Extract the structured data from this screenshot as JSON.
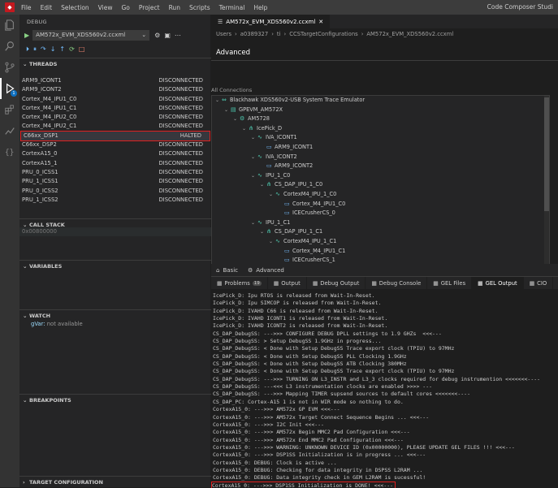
{
  "titlebar": {
    "menu": [
      "File",
      "Edit",
      "Selection",
      "View",
      "Go",
      "Project",
      "Run",
      "Scripts",
      "Terminal",
      "Help"
    ],
    "app_title": "Code Composer Studi"
  },
  "activity": {
    "debug_badge": "1"
  },
  "debug_panel": {
    "title": "DEBUG",
    "config": "AM572x_EVM_XDS560v2.ccxml",
    "sections": {
      "threads": "THREADS",
      "call_stack": "CALL STACK",
      "variables": "VARIABLES",
      "watch": "WATCH",
      "breakpoints": "BREAKPOINTS",
      "target_config": "TARGET CONFIGURATION"
    },
    "threads": [
      {
        "name": "ARM9_ICONT1",
        "status": "DISCONNECTED"
      },
      {
        "name": "ARM9_ICONT2",
        "status": "DISCONNECTED"
      },
      {
        "name": "Cortex_M4_IPU1_C0",
        "status": "DISCONNECTED"
      },
      {
        "name": "Cortex_M4_IPU1_C1",
        "status": "DISCONNECTED"
      },
      {
        "name": "Cortex_M4_IPU2_C0",
        "status": "DISCONNECTED"
      },
      {
        "name": "Cortex_M4_IPU2_C1",
        "status": "DISCONNECTED"
      },
      {
        "name": "C66xx_DSP1",
        "status": "HALTED"
      },
      {
        "name": "C66xx_DSP2",
        "status": "DISCONNECTED"
      },
      {
        "name": "CortexA15_0",
        "status": "DISCONNECTED"
      },
      {
        "name": "CortexA15_1",
        "status": "DISCONNECTED"
      },
      {
        "name": "PRU_0_ICSS1",
        "status": "DISCONNECTED"
      },
      {
        "name": "PRU_1_ICSS1",
        "status": "DISCONNECTED"
      },
      {
        "name": "PRU_0_ICSS2",
        "status": "DISCONNECTED"
      },
      {
        "name": "PRU_1_ICSS2",
        "status": "DISCONNECTED"
      }
    ],
    "call_stack_frame": "0x00800000",
    "watch": {
      "name": "gVar",
      "value": "not available"
    }
  },
  "editor": {
    "tab": "AM572x_EVM_XDS560v2.ccxml",
    "breadcrumbs": [
      "Users",
      "a0389327",
      "ti",
      "CCSTargetConfigurations",
      "AM572x_EVM_XDS560v2.ccxml"
    ],
    "heading": "Advanced",
    "all_connections": "All Connections",
    "tree": [
      {
        "label": "Blackhawk XDS560v2-USB System Trace Emulator",
        "depth": 0,
        "icon": "connection"
      },
      {
        "label": "GPEVM_AM572X",
        "depth": 1,
        "icon": "board"
      },
      {
        "label": "AM5728",
        "depth": 2,
        "icon": "cpu"
      },
      {
        "label": "IcePick_D",
        "depth": 3,
        "icon": "router"
      },
      {
        "label": "IVA_ICONT1",
        "depth": 4,
        "icon": "wave"
      },
      {
        "label": "ARM9_ICONT1",
        "depth": 5,
        "icon": "monitor"
      },
      {
        "label": "IVA_ICONT2",
        "depth": 4,
        "icon": "wave"
      },
      {
        "label": "ARM9_ICONT2",
        "depth": 5,
        "icon": "monitor"
      },
      {
        "label": "IPU_1_C0",
        "depth": 4,
        "icon": "wave"
      },
      {
        "label": "CS_DAP_IPU_1_C0",
        "depth": 5,
        "icon": "router"
      },
      {
        "label": "CortexM4_IPU_1_C0",
        "depth": 6,
        "icon": "wave"
      },
      {
        "label": "Cortex_M4_IPU1_C0",
        "depth": 7,
        "icon": "monitor"
      },
      {
        "label": "ICECrusherCS_0",
        "depth": 7,
        "icon": "monitor"
      },
      {
        "label": "IPU_1_C1",
        "depth": 4,
        "icon": "wave"
      },
      {
        "label": "CS_DAP_IPU_1_C1",
        "depth": 5,
        "icon": "router"
      },
      {
        "label": "CortexM4_IPU_1_C1",
        "depth": 6,
        "icon": "wave"
      },
      {
        "label": "Cortex_M4_IPU1_C1",
        "depth": 7,
        "icon": "monitor"
      },
      {
        "label": "ICECrusherCS_1",
        "depth": 7,
        "icon": "monitor"
      }
    ],
    "bottom_tabs": {
      "basic": "Basic",
      "advanced": "Advanced"
    }
  },
  "panel": {
    "tabs": [
      {
        "label": "Problems",
        "badge": "19",
        "active": false
      },
      {
        "label": "Output",
        "active": false
      },
      {
        "label": "Debug Output",
        "active": false
      },
      {
        "label": "Debug Console",
        "active": false
      },
      {
        "label": "GEL Files",
        "active": false
      },
      {
        "label": "GEL Output",
        "active": true
      },
      {
        "label": "CIO",
        "active": false
      }
    ],
    "console_lines": [
      "IcePick_D: Ipu RTOS is released from Wait-In-Reset.",
      "IcePick_D: Ipu SIMCOP is released from Wait-In-Reset.",
      "IcePick_D: IVAHD C66 is released from Wait-In-Reset.",
      "IcePick_D: IVAHD ICONT1 is released from Wait-In-Reset.",
      "IcePick_D: IVAHD ICONT2 is released from Wait-In-Reset.",
      "CS_DAP_DebugSS: --->>> CONFIGURE DEBUG DPLL settings to 1.9 GHZs  <<<---",
      "CS_DAP_DebugSS: > Setup DebugSS 1.9GHz in progress...",
      "CS_DAP_DebugSS: < Done with Setup DebugSS Trace export clock (TPIU) to 97MHz",
      "CS_DAP_DebugSS: < Done with Setup DebugSS PLL Clocking 1.9GHz",
      "CS_DAP_DebugSS: < Done with Setup DebugSS ATB Clocking 380MHz",
      "CS_DAP_DebugSS: < Done with Setup DebugSS Trace export clock (TPIU) to 97MHz",
      "CS_DAP_DebugSS: --->>> TURNING ON L3_INSTR and L3_3 clocks required for debug instrumention <<<<<<<----",
      "CS_DAP_DebugSS: ---<<< L3 instrumentation clocks are enabled >>>> ---",
      "CS_DAP_DebugSS: --->>> Mapping TIMER supsend sources to default cores <<<<<<<----",
      "CS_DAP_PC: Cortex-A15 1 is not in WIR mode so nothing to do.",
      "CortexA15_0: --->>> AM572x GP EVM <<<---",
      "CortexA15_0: --->>> AM572x Target Connect Sequence Begins ... <<<---",
      "CortexA15_0: --->>> I2C Init <<<---",
      "CortexA15_0: --->>> AM572x Begin MMC2 Pad Configuration <<<---",
      "CortexA15_0: --->>> AM572x End MMC2 Pad Configuration <<<---",
      "CortexA15_0: --->>> WARNING: UNKNOWN DEVICE ID (0x00000000), PLEASE UPDATE GEL FILES !!! <<<---",
      "CortexA15_0: --->>> DSP1SS Initialization is in progress ... <<<---",
      "CortexA15_0: DEBUG: Clock is active ...",
      "CortexA15_0: DEBUG: Checking for data integrity in DSPSS L2RAM ...",
      "CortexA15_0: DEBUG: Data integrity check in GEM L2RAM is sucessful!",
      "CortexA15_0: --->>> DSP1SS Initialization is DONE! <<<---"
    ]
  }
}
